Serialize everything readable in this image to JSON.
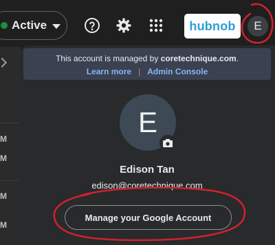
{
  "topbar": {
    "status_label": "Active",
    "status_color": "#1e8e3e",
    "help_icon": "help-circle-icon",
    "settings_icon": "gear-icon",
    "apps_icon": "apps-grid-icon",
    "brand_logo_text_a": "hub",
    "brand_logo_text_b": "nob",
    "avatar_initial": "E"
  },
  "left_strip": {
    "row_letters": [
      "M",
      "M",
      "M",
      "M"
    ]
  },
  "account_panel": {
    "banner": {
      "text_prefix": "This account is managed by ",
      "domain": "coretechnique.com",
      "text_suffix": ".",
      "learn_more": "Learn more",
      "admin_console": "Admin Console"
    },
    "avatar_initial": "E",
    "camera_icon": "camera-icon",
    "name": "Edison Tan",
    "email": "edison@coretechnique.com",
    "manage_account_button": "Manage your Google Account"
  },
  "colors": {
    "background": "#1f1f1f",
    "panel": "#282a2c",
    "banner": "#3b4150",
    "link": "#8ab4f8",
    "annotation_red": "#d4212b"
  }
}
